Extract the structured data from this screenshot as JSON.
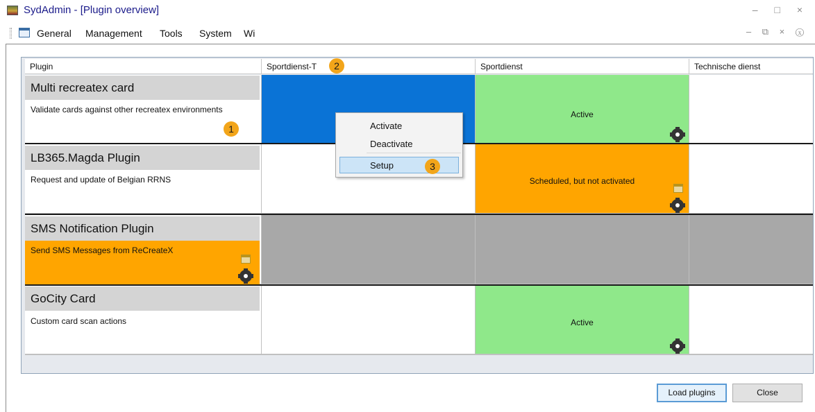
{
  "window": {
    "title": "SydAdmin - [Plugin overview]",
    "controls": "– □ ×",
    "mdi_controls": "– ⧉ × ⓧ"
  },
  "menu": {
    "items": [
      "General",
      "Management",
      "Tools",
      "System",
      "Wi"
    ]
  },
  "grid": {
    "columns": [
      "Plugin",
      "Sportdienst-T",
      "Sportdienst",
      "Technische dienst"
    ],
    "rows": [
      {
        "name": "Multi recreatex card",
        "description": "Validate cards against other recreatex environments",
        "cells": [
          "",
          "",
          "Active",
          ""
        ]
      },
      {
        "name": "LB365.Magda Plugin",
        "description": "Request and update of Belgian RRNS",
        "cells": [
          "",
          "",
          "Scheduled, but not activated",
          ""
        ]
      },
      {
        "name": "SMS Notification Plugin",
        "description": "Send SMS Messages from ReCreateX",
        "cells": [
          "",
          "",
          "",
          ""
        ]
      },
      {
        "name": "GoCity Card",
        "description": "Custom card scan actions",
        "cells": [
          "",
          "",
          "Active",
          ""
        ]
      }
    ]
  },
  "context_menu": {
    "items": [
      "Activate",
      "Deactivate",
      "Setup"
    ],
    "highlighted": "Setup"
  },
  "badges": [
    "1",
    "2",
    "3"
  ],
  "buttons": {
    "load_plugins": "Load plugins",
    "close": "Close"
  },
  "colors": {
    "selected": "#0a73d6",
    "active": "#8fe88a",
    "scheduled": "#ffa500",
    "disabled": "#a8a8a8",
    "header": "#d4d4d4",
    "badge": "#f2a51a"
  },
  "icons": {
    "settings": "gear-icon",
    "schedule": "calendar-icon"
  }
}
